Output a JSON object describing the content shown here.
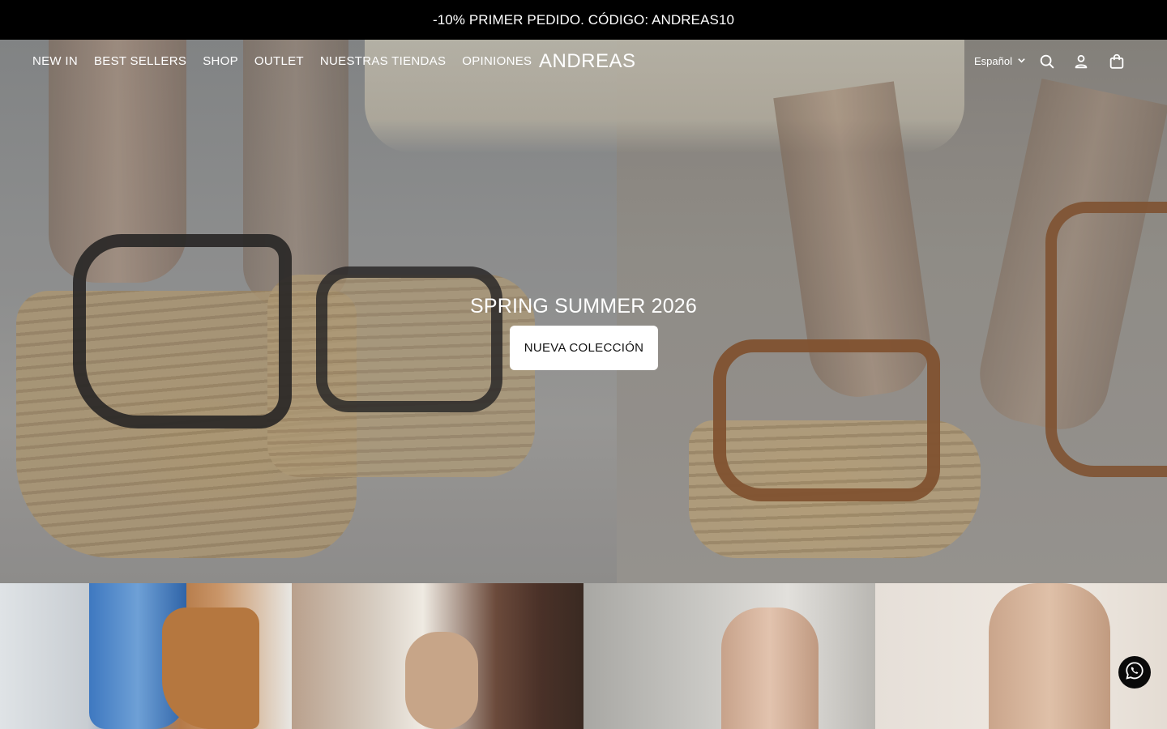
{
  "announcement": {
    "text": "-10% PRIMER PEDIDO. CÓDIGO: ANDREAS10"
  },
  "header": {
    "nav": [
      "NEW IN",
      "BEST SELLERS",
      "SHOP",
      "OUTLET",
      "NUESTRAS TIENDAS",
      "OPINIONES"
    ],
    "logo": "ANDREAS",
    "language": "Español",
    "icons": [
      "search-icon",
      "account-icon",
      "cart-icon"
    ]
  },
  "hero": {
    "title": "SPRING SUMMER 2026",
    "cta": "NUEVA COLECCIÓN"
  },
  "tiles": [
    "boots-tile",
    "loafers-tile",
    "sandals-tile",
    "flats-tile"
  ],
  "whatsapp": {
    "icon": "whatsapp-icon"
  },
  "colors": {
    "announcement_bg": "#000000",
    "button_bg": "#ffffff",
    "text_on_hero": "#ffffff"
  }
}
